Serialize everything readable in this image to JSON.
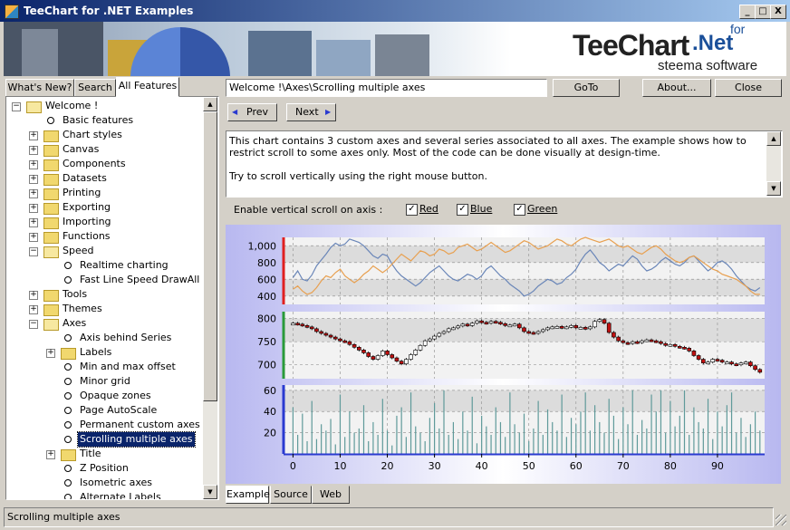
{
  "window": {
    "title": "TeeChart for .NET Examples",
    "minimize": "_",
    "maximize": "□",
    "close": "X"
  },
  "banner": {
    "logo_main": "TeeChart",
    "logo_for": "for",
    "logo_net": ".Net",
    "logo_sub": "steema software"
  },
  "tabs": [
    {
      "label": "What's New?",
      "active": false
    },
    {
      "label": "Search",
      "active": false
    },
    {
      "label": "All Features",
      "active": true
    }
  ],
  "tree": [
    {
      "label": "Welcome !",
      "level": 0,
      "type": "folder-open",
      "expander": "-"
    },
    {
      "label": "Basic features",
      "level": 1,
      "type": "leaf"
    },
    {
      "label": "Chart styles",
      "level": 1,
      "type": "folder",
      "expander": "+"
    },
    {
      "label": "Canvas",
      "level": 1,
      "type": "folder",
      "expander": "+"
    },
    {
      "label": "Components",
      "level": 1,
      "type": "folder",
      "expander": "+"
    },
    {
      "label": "Datasets",
      "level": 1,
      "type": "folder",
      "expander": "+"
    },
    {
      "label": "Printing",
      "level": 1,
      "type": "folder",
      "expander": "+"
    },
    {
      "label": "Exporting",
      "level": 1,
      "type": "folder",
      "expander": "+"
    },
    {
      "label": "Importing",
      "level": 1,
      "type": "folder",
      "expander": "+"
    },
    {
      "label": "Functions",
      "level": 1,
      "type": "folder",
      "expander": "+"
    },
    {
      "label": "Speed",
      "level": 1,
      "type": "folder-open",
      "expander": "-"
    },
    {
      "label": "Realtime charting",
      "level": 2,
      "type": "leaf"
    },
    {
      "label": "Fast Line Speed DrawAll",
      "level": 2,
      "type": "leaf"
    },
    {
      "label": "Tools",
      "level": 1,
      "type": "folder",
      "expander": "+"
    },
    {
      "label": "Themes",
      "level": 1,
      "type": "folder",
      "expander": "+"
    },
    {
      "label": "Axes",
      "level": 1,
      "type": "folder-open",
      "expander": "-"
    },
    {
      "label": "Axis behind Series",
      "level": 2,
      "type": "leaf"
    },
    {
      "label": "Labels",
      "level": 2,
      "type": "folder",
      "expander": "+"
    },
    {
      "label": "Min and max offset",
      "level": 2,
      "type": "leaf"
    },
    {
      "label": "Minor grid",
      "level": 2,
      "type": "leaf"
    },
    {
      "label": "Opaque zones",
      "level": 2,
      "type": "leaf"
    },
    {
      "label": "Page AutoScale",
      "level": 2,
      "type": "leaf"
    },
    {
      "label": "Permanent custom axes",
      "level": 2,
      "type": "leaf"
    },
    {
      "label": "Scrolling multiple axes",
      "level": 2,
      "type": "leaf",
      "selected": true
    },
    {
      "label": "Title",
      "level": 2,
      "type": "folder",
      "expander": "+"
    },
    {
      "label": "Z Position",
      "level": 2,
      "type": "leaf"
    },
    {
      "label": "Isometric axes",
      "level": 2,
      "type": "leaf"
    },
    {
      "label": "Alternate Labels",
      "level": 2,
      "type": "leaf"
    }
  ],
  "path_field": {
    "value": "Welcome !\\Axes\\Scrolling multiple axes"
  },
  "buttons": {
    "goto": "GoTo",
    "about": "About...",
    "close": "Close",
    "prev": "Prev",
    "next": "Next"
  },
  "description": {
    "line1": "This chart contains 3 custom axes and several series associated to all axes.  The example shows how to restrict scroll to some axes only. Most of the code can be done visually at design-time.",
    "line2": "Try to scroll vertically using the right mouse button."
  },
  "scroll_options": {
    "label": "Enable vertical scroll on axis :",
    "checkboxes": [
      {
        "label": "Red",
        "checked": true
      },
      {
        "label": "Blue",
        "checked": true
      },
      {
        "label": "Green",
        "checked": true
      }
    ]
  },
  "chart_data": {
    "type": "line",
    "x_ticks": [
      "0",
      "10",
      "20",
      "30",
      "40",
      "50",
      "60",
      "70",
      "80",
      "90"
    ],
    "xlim": [
      -2,
      100
    ],
    "panels": [
      {
        "axis_color": "#e02020",
        "ticks": [
          "1,000",
          "800",
          "600",
          "400"
        ],
        "tick_values": [
          1000,
          800,
          600,
          400
        ],
        "ylim": [
          300,
          1100
        ],
        "series": [
          {
            "color": "#6a86b8",
            "values": [
              620,
              700,
              600,
              580,
              650,
              760,
              830,
              900,
              980,
              1030,
              1000,
              1020,
              1080,
              1060,
              1040,
              1000,
              940,
              880,
              850,
              900,
              880,
              780,
              700,
              640,
              600,
              560,
              520,
              560,
              620,
              680,
              720,
              760,
              700,
              640,
              600,
              580,
              620,
              660,
              640,
              600,
              640,
              720,
              760,
              700,
              640,
              600,
              540,
              500,
              460,
              400,
              420,
              460,
              520,
              560,
              600,
              580,
              540,
              560,
              620,
              660,
              720,
              820,
              900,
              950,
              880,
              800,
              760,
              700,
              740,
              780,
              760,
              820,
              880,
              840,
              760,
              700,
              720,
              760,
              820,
              860,
              820,
              780,
              760,
              800,
              860,
              880,
              820,
              760,
              700,
              740,
              800,
              820,
              780,
              720,
              640,
              580,
              520,
              480,
              460,
              500
            ]
          },
          {
            "color": "#e8a050",
            "values": [
              480,
              520,
              460,
              420,
              440,
              500,
              580,
              640,
              620,
              680,
              720,
              640,
              600,
              560,
              600,
              660,
              700,
              760,
              720,
              680,
              720,
              780,
              840,
              900,
              860,
              820,
              880,
              940,
              920,
              880,
              900,
              960,
              940,
              900,
              920,
              980,
              1000,
              1020,
              980,
              940,
              960,
              1000,
              1040,
              1000,
              960,
              920,
              940,
              980,
              1020,
              1060,
              1040,
              1000,
              960,
              980,
              1000,
              1040,
              1080,
              1060,
              1020,
              1000,
              1040,
              1080,
              1100,
              1080,
              1060,
              1040,
              1060,
              1080,
              1040,
              1000,
              980,
              1000,
              960,
              920,
              900,
              940,
              980,
              1000,
              960,
              900,
              860,
              820,
              800,
              820,
              860,
              880,
              840,
              800,
              760,
              720,
              700,
              660,
              640,
              620,
              600,
              560,
              520,
              460,
              420,
              420
            ]
          }
        ]
      },
      {
        "axis_color": "#2a9a3a",
        "ticks": [
          "800",
          "750",
          "700"
        ],
        "tick_values": [
          800,
          750,
          700
        ],
        "ylim": [
          670,
          815
        ],
        "series": [
          {
            "type": "candle",
            "color_up": "#ffffff",
            "color_down": "#c01010",
            "values": [
              790,
              788,
              785,
              782,
              778,
              772,
              768,
              764,
              760,
              756,
              752,
              750,
              744,
              738,
              732,
              726,
              718,
              712,
              720,
              730,
              722,
              715,
              708,
              702,
              712,
              722,
              732,
              742,
              752,
              756,
              762,
              768,
              772,
              778,
              780,
              784,
              788,
              785,
              790,
              795,
              792,
              790,
              794,
              792,
              789,
              785,
              786,
              788,
              780,
              772,
              770,
              768,
              772,
              776,
              780,
              782,
              783,
              780,
              782,
              785,
              780,
              781,
              778,
              782,
              794,
              798,
              790,
              770,
              760,
              752,
              748,
              746,
              750,
              748,
              752,
              754,
              752,
              750,
              746,
              742,
              744,
              740,
              738,
              736,
              730,
              720,
              712,
              704,
              706,
              712,
              710,
              706,
              706,
              702,
              700,
              704,
              706,
              698,
              690,
              684
            ]
          }
        ]
      },
      {
        "axis_color": "#2a3ad0",
        "ticks": [
          "60",
          "40",
          "20"
        ],
        "tick_values": [
          60,
          40,
          20
        ],
        "ylim": [
          0,
          65
        ],
        "series": [
          {
            "type": "bar",
            "color": "#5f9a9a",
            "values": [
              44,
              18,
              38,
              12,
              50,
              14,
              28,
              22,
              33,
              9,
              56,
              16,
              40,
              20,
              24,
              46,
              12,
              30,
              18,
              52,
              22,
              8,
              36,
              44,
              16,
              58,
              26,
              20,
              12,
              34,
              48,
              24,
              60,
              18,
              30,
              14,
              40,
              22,
              54,
              10,
              36,
              26,
              18,
              44,
              30,
              16,
              58,
              28,
              20,
              38,
              12,
              24,
              50,
              18,
              42,
              30,
              22,
              56,
              16,
              34,
              28,
              40,
              58,
              22,
              46,
              30,
              20,
              52,
              36,
              14,
              44,
              28,
              60,
              18,
              32,
              24,
              56,
              40,
              60,
              20,
              50,
              26,
              36,
              60,
              18,
              44,
              30,
              24,
              52,
              14,
              40,
              26,
              46,
              58,
              20,
              34,
              16,
              28,
              40,
              22
            ]
          }
        ]
      }
    ]
  },
  "bottom_tabs": [
    {
      "label": "Example",
      "active": true
    },
    {
      "label": "Source",
      "active": false
    },
    {
      "label": "Web",
      "active": false
    }
  ],
  "status": {
    "text": "Scrolling multiple axes"
  }
}
